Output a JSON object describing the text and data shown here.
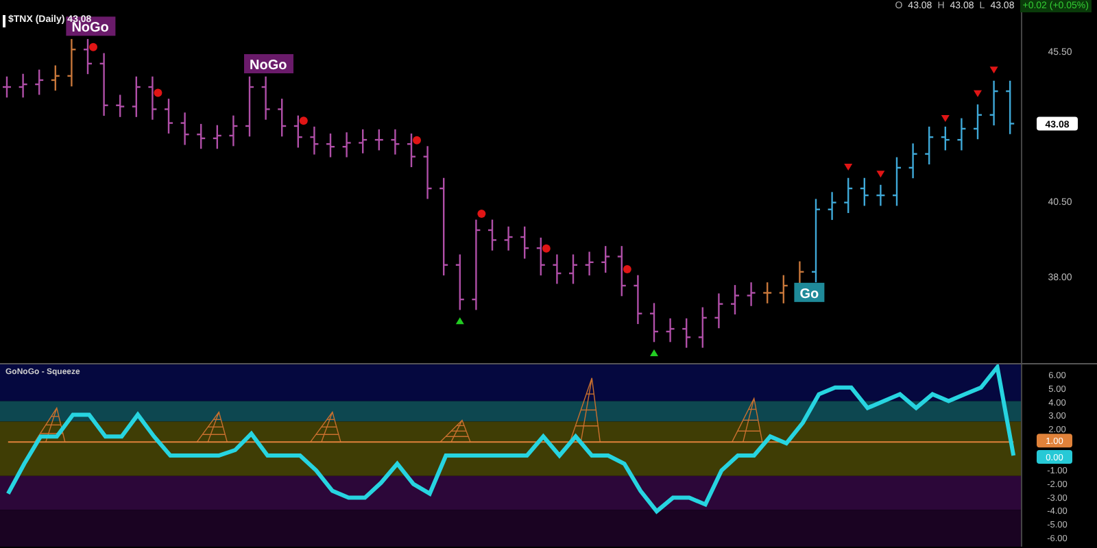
{
  "quote_bar": {
    "items": [
      {
        "kind": "label",
        "text": "O"
      },
      {
        "kind": "value",
        "text": "43.08"
      },
      {
        "kind": "label",
        "text": "H"
      },
      {
        "kind": "value",
        "text": "43.08"
      },
      {
        "kind": "label",
        "text": "L"
      },
      {
        "kind": "value",
        "text": "43.08"
      },
      {
        "kind": "change",
        "text": "+0.02 (+0.05%)"
      }
    ]
  },
  "price_panel": {
    "title": "$TNX (Daily) 43.08",
    "last_price": "43.08",
    "axis_labels": [
      "45.50",
      "40.50",
      "38.00"
    ],
    "signals": [
      {
        "kind": "label",
        "text": "NoGo",
        "color": "#6a1b6a"
      },
      {
        "kind": "label",
        "text": "NoGo",
        "color": "#6a1b6a"
      },
      {
        "kind": "label",
        "text": "Go",
        "color": "#1f8a99"
      },
      {
        "kind": "dot"
      },
      {
        "kind": "dot"
      },
      {
        "kind": "dot"
      },
      {
        "kind": "dot"
      },
      {
        "kind": "dot"
      },
      {
        "kind": "dot"
      },
      {
        "kind": "dot"
      },
      {
        "kind": "up"
      },
      {
        "kind": "up"
      },
      {
        "kind": "down"
      },
      {
        "kind": "down"
      },
      {
        "kind": "down"
      },
      {
        "kind": "down"
      },
      {
        "kind": "down"
      }
    ]
  },
  "oscillator_panel": {
    "title": "GoNoGo - Squeeze",
    "value_tags": [
      {
        "text": "1.00",
        "color": "#e0823a"
      },
      {
        "text": "0.00",
        "color": "#27c9d6"
      }
    ],
    "chart_data": {
      "type": "line",
      "ylim": [
        -6.7,
        6.7
      ],
      "yticks": [
        {
          "value": 6,
          "label": "6.00"
        },
        {
          "value": 5,
          "label": "5.00"
        },
        {
          "value": 4,
          "label": "4.00"
        },
        {
          "value": 3,
          "label": "3.00"
        },
        {
          "value": 2,
          "label": "2.00"
        },
        {
          "value": -1,
          "label": "-1.00"
        },
        {
          "value": -2,
          "label": "-2.00"
        },
        {
          "value": -3,
          "label": "-3.00"
        },
        {
          "value": -4,
          "label": "-4.00"
        },
        {
          "value": -5,
          "label": "-5.00"
        },
        {
          "value": -6,
          "label": "-6.00"
        }
      ],
      "series": [
        {
          "color": "#e0823a",
          "values": [
            1,
            1,
            1,
            1,
            1,
            1,
            1,
            1,
            1,
            1,
            1,
            1,
            1,
            1,
            1,
            1,
            1,
            1,
            1,
            1,
            1,
            1,
            1,
            1,
            1,
            1,
            1,
            1,
            1,
            1,
            1,
            1,
            1,
            1,
            1,
            1,
            1,
            1,
            1,
            1,
            1,
            1,
            1,
            1,
            1,
            1,
            1,
            1,
            1,
            1,
            1,
            1,
            1,
            1,
            1,
            1,
            1,
            1,
            1,
            1,
            1,
            1,
            1
          ]
        },
        {
          "color": "#27d4e0",
          "values": [
            -2.8,
            -0.6,
            1.4,
            1.4,
            3.0,
            3.0,
            1.4,
            1.4,
            3.0,
            1.4,
            0,
            0,
            0,
            0,
            0.4,
            1.6,
            0,
            0,
            0,
            -1.1,
            -2.6,
            -3.1,
            -3.1,
            -2.0,
            -0.6,
            -2.1,
            -2.8,
            0,
            0,
            0,
            0,
            0,
            0,
            1.4,
            0,
            1.4,
            0,
            0,
            -0.6,
            -2.6,
            -4.1,
            -3.1,
            -3.1,
            -3.6,
            -1.1,
            0,
            0,
            1.4,
            0.9,
            2.4,
            4.5,
            5.0,
            5.0,
            3.5,
            4.0,
            4.5,
            3.5,
            4.5,
            4.0,
            4.5,
            5.0,
            6.5,
            0
          ]
        }
      ]
    }
  }
}
